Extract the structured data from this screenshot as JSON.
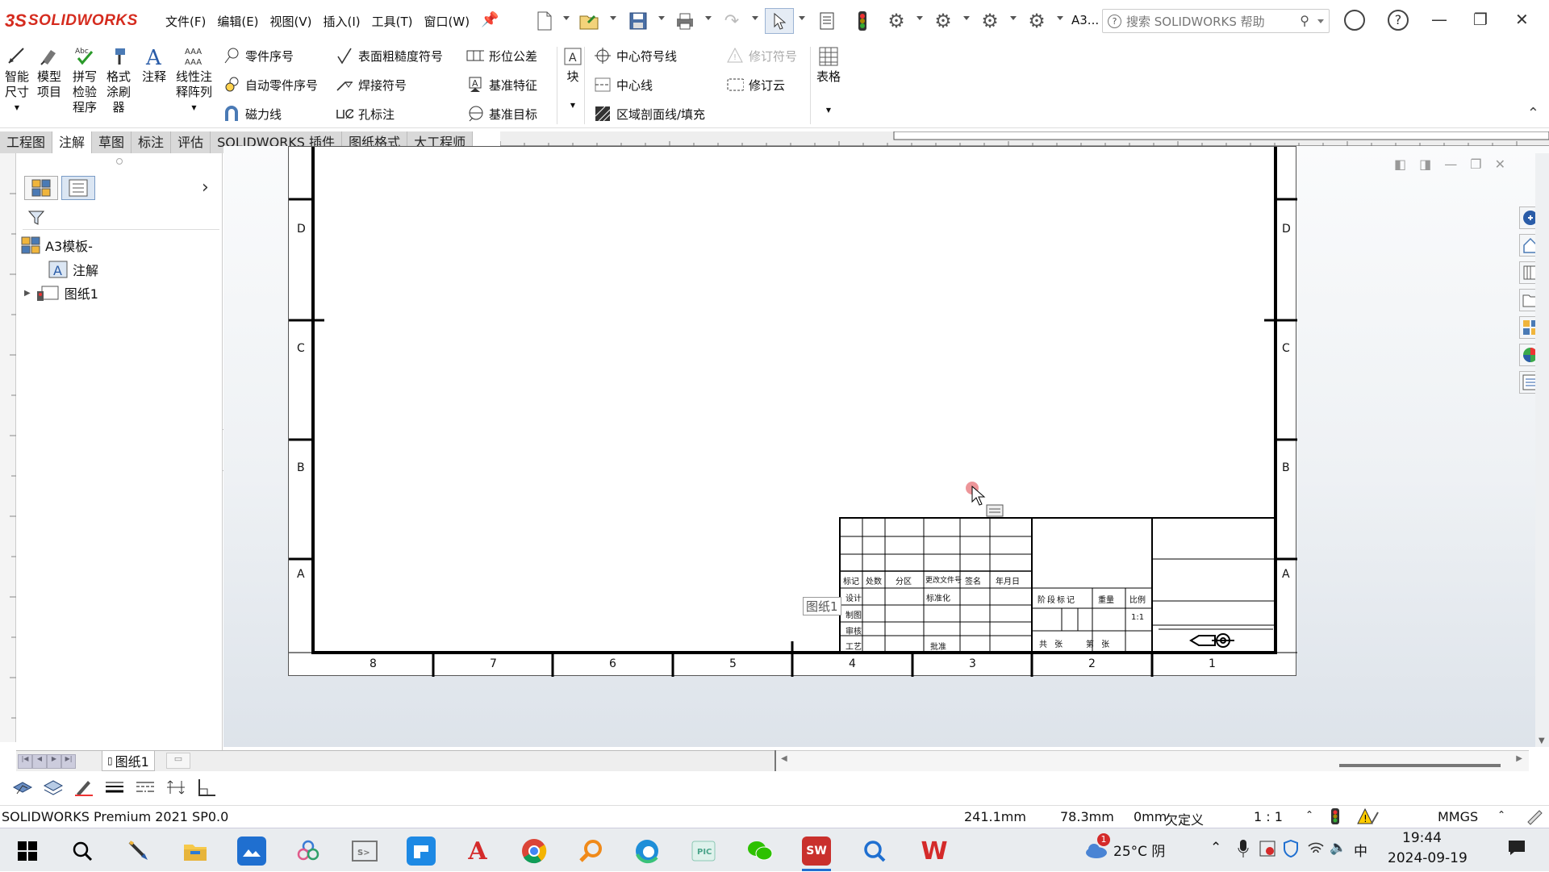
{
  "app": {
    "logo_ds": "3S",
    "logo_sw": "SOLIDWORKS",
    "menus": [
      "文件(F)",
      "编辑(E)",
      "视图(V)",
      "插入(I)",
      "工具(T)",
      "窗口(W)"
    ],
    "doc_title": "A3...",
    "search_placeholder": "搜索 SOLIDWORKS 帮助"
  },
  "ribbon": {
    "smart_dim": "智能\n尺寸",
    "model_items": "模型\n项目",
    "spell_check": "拼写\n检验\n程序",
    "format_painter": "格式\n涂刷\n器",
    "note": "注释",
    "linear_note": "线性注\n释阵列",
    "balloon": "零件序号",
    "auto_balloon": "自动零件序号",
    "magnetic_line": "磁力线",
    "surface_finish": "表面粗糙度符号",
    "weld_symbol": "焊接符号",
    "hole_callout": "孔标注",
    "gdt": "形位公差",
    "datum_feature": "基准特征",
    "datum_target": "基准目标",
    "block": "块",
    "center_mark": "中心符号线",
    "centerline": "中心线",
    "area_hatch": "区域剖面线/填充",
    "revision_symbol": "修订符号",
    "revision_cloud": "修订云",
    "tables": "表格"
  },
  "tabs": [
    "工程图",
    "注解",
    "草图",
    "标注",
    "评估",
    "SOLIDWORKS 插件",
    "图纸格式",
    "大工程师"
  ],
  "active_tab": "注解",
  "tree": {
    "root": "A3模板-",
    "annotations": "注解",
    "sheet": "图纸1"
  },
  "drawing": {
    "zone_rows": [
      "D",
      "C",
      "B",
      "A"
    ],
    "zone_cols": [
      "8",
      "7",
      "6",
      "5",
      "4",
      "3",
      "2",
      "1"
    ],
    "sheet_label": "图纸1",
    "title_block_headers": [
      "标记",
      "处数",
      "分区",
      "更改文件号",
      "签名",
      "年月日"
    ],
    "title_block_rows": [
      "设计",
      "制图",
      "审核",
      "工艺"
    ],
    "standardization": "标准化",
    "approve": "批准",
    "stage_mark": "阶段标记",
    "weight": "重量",
    "scale_label": "比例",
    "scale_value": "1:1",
    "sheets_total": "共  张",
    "sheet_num": "第  张"
  },
  "sheet_tab": "图纸1",
  "status": {
    "product": "SOLIDWORKS Premium 2021 SP0.0",
    "x": "241.1mm",
    "y": "78.3mm",
    "z": "0mm",
    "state": "欠定义",
    "scale": "1 : 1",
    "units": "MMGS"
  },
  "taskbar": {
    "weather": "25°C 阴",
    "weather_badge": "1",
    "ime": "中",
    "time": "19:44",
    "date": "2024-09-19"
  },
  "colors": {
    "accent": "#d52b1e",
    "tab_bg": "#d9d9d9",
    "canvas_top": "#fafbfc",
    "canvas_bottom": "#dde3ea"
  }
}
